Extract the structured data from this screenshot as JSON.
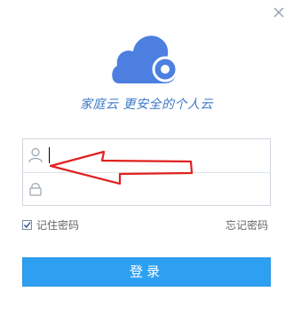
{
  "brand": {
    "tagline": "家庭云 更安全的个人云",
    "logo_icon": "cloud-logo-icon",
    "accent_color": "#4c7fe0"
  },
  "form": {
    "username": {
      "value": "",
      "icon": "user-icon"
    },
    "password": {
      "value": "",
      "icon": "lock-icon"
    }
  },
  "options": {
    "remember_label": "记住密码",
    "remember_checked": true,
    "forgot_label": "忘记密码"
  },
  "actions": {
    "login_label": "登录",
    "login_color": "#2ea0f2"
  },
  "annotation": {
    "arrow_color": "#e02020"
  },
  "window": {
    "close_icon": "close-icon"
  }
}
